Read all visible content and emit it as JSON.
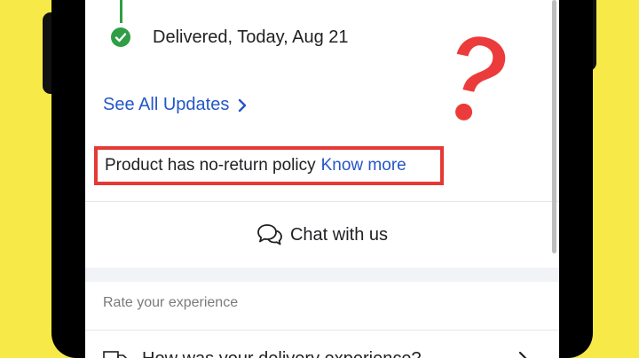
{
  "tracking": {
    "status_label": "Delivered, Today, Aug 21",
    "see_all_label": "See All Updates"
  },
  "policy": {
    "text": "Product has no-return policy",
    "link_label": "Know more"
  },
  "chat": {
    "label": "Chat with us"
  },
  "rating": {
    "section_title": "Rate your experience",
    "delivery_question": "How was your delivery experience?"
  },
  "colors": {
    "background": "#f7ea48",
    "link": "#2456c7",
    "success": "#2f9e44",
    "highlight": "#e53935"
  },
  "icons": [
    "check-icon",
    "chevron-right-icon",
    "chat-bubbles-icon",
    "truck-icon",
    "question-mark-icon"
  ]
}
